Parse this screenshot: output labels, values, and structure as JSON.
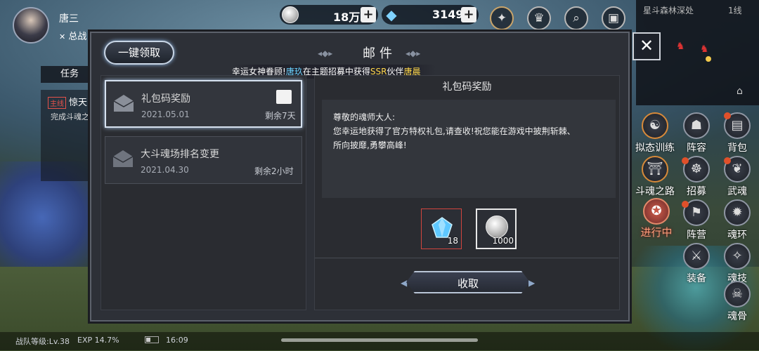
{
  "player": {
    "name": "唐三",
    "combat_label": "总战"
  },
  "resources": {
    "coins": "18万",
    "gems": "3149",
    "plus": "+"
  },
  "minimap": {
    "name": "星斗森林深处",
    "line": "1线"
  },
  "task": {
    "tab": "任务",
    "tag": "主线",
    "title": "惊天",
    "desc": "完成斗魂之"
  },
  "side_menu": [
    "拟态训练",
    "阵容",
    "背包",
    "斗魂之路",
    "招募",
    "武魂",
    "阵营",
    "魂环",
    "装备",
    "魂技",
    "魂骨"
  ],
  "event_banner": "进行中",
  "mail": {
    "title": "邮件",
    "claim_all": "一键领取",
    "ticker": {
      "prefix": "幸运女神眷顾!",
      "player": "唐玖",
      "mid": "在主题招募中获得",
      "rarity": "SSR",
      "mid2": "伙伴",
      "partner": "唐晨"
    },
    "items": [
      {
        "subject": "礼包码奖励",
        "date": "2021.05.01",
        "remain": "剩余7天"
      },
      {
        "subject": "大斗魂场排名变更",
        "date": "2021.04.30",
        "remain": "剩余2小时"
      }
    ],
    "detail": {
      "title": "礼包码奖励",
      "lines": [
        "尊敬的魂师大人:",
        "您幸运地获得了官方特权礼包,请查收!祝您能在游戏中披荆斩棘、",
        "所向披靡,勇攀高峰!"
      ],
      "rewards": [
        {
          "icon": "gem-icon",
          "count": "18"
        },
        {
          "icon": "coin-icon",
          "count": "1000"
        }
      ],
      "collect": "收取"
    }
  },
  "status": {
    "team_level": "战队等级:Lv.38",
    "exp": "EXP 14.7%",
    "time": "16:09"
  },
  "colors": {
    "accent_blue": "#6ad2ff",
    "gold": "#ffd84a",
    "red": "#e6524a"
  }
}
